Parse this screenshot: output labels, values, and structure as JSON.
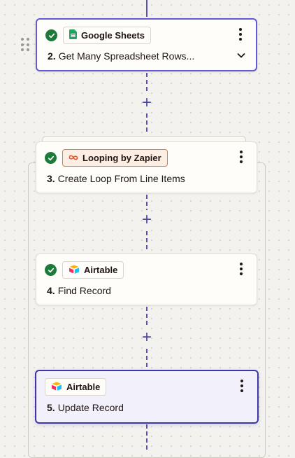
{
  "steps": [
    {
      "app": "Google Sheets",
      "app_icon": "google-sheets-icon",
      "number": "2.",
      "title": "Get Many Spreadsheet Rows...",
      "status": "complete",
      "state": "selected"
    },
    {
      "app": "Looping by Zapier",
      "app_icon": "looping-infinity-icon",
      "number": "3.",
      "title": "Create Loop From Line Items",
      "status": "complete",
      "state": "default"
    },
    {
      "app": "Airtable",
      "app_icon": "airtable-icon",
      "number": "4.",
      "title": "Find Record",
      "status": "complete",
      "state": "default"
    },
    {
      "app": "Airtable",
      "app_icon": "airtable-icon",
      "number": "5.",
      "title": "Update Record",
      "status": "none",
      "state": "active"
    }
  ],
  "connector": {
    "add_label": "+"
  },
  "colors": {
    "accent": "#6358d6",
    "active_border": "#3d35a8",
    "success": "#1c7a3a",
    "loop_chip_bg": "#fdeee4",
    "loop_chip_border": "#e07b47"
  }
}
